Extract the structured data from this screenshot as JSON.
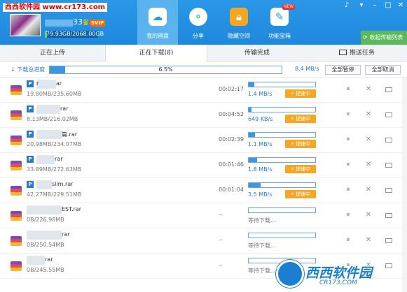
{
  "site_watermark": "西西软件园 www.cr173.com",
  "user": {
    "name_visible": "33",
    "badge": "SVIP",
    "quota_text": "79.93GB/2068.00GB",
    "quota_fraction": 0.0386
  },
  "nav": [
    {
      "label": "我的网盘",
      "icon": "cloud-icon",
      "active": true
    },
    {
      "label": "分享",
      "icon": "share-icon",
      "active": false
    },
    {
      "label": "隐藏空间",
      "icon": "lock-icon",
      "active": false
    },
    {
      "label": "功能宝箱",
      "icon": "toolbox-icon",
      "active": false,
      "badge": "NEW"
    }
  ],
  "window_controls": [
    "bell-icon",
    "menu-icon",
    "minimize-icon",
    "maximize-icon",
    "close-icon"
  ],
  "transfer_list_button": "收起传输列表",
  "tabs": {
    "upload": "正在上传",
    "download": "正在下载(8)",
    "done": "传输完成",
    "push": "推送任务"
  },
  "summary": {
    "label": "下载总进度",
    "percent_text": "6.5%",
    "fraction": 0.065,
    "speed": "8.4 MB/s",
    "pause_all": "全部暂停",
    "cancel_all": "全部取消"
  },
  "downloads": [
    {
      "name": "r",
      "ext": "ar",
      "size": "19.80MB/235.60MB",
      "time": "00:02:17",
      "speed": "1.4 MB/s",
      "fraction": 0.084,
      "boost": "提速中",
      "status": "downloading",
      "has_p": true
    },
    {
      "name": "",
      "ext": "rar",
      "size": "8.13MB/216.02MB",
      "time": "00:04:52",
      "speed": "649 KB/s",
      "fraction": 0.038,
      "boost": "提速中",
      "status": "downloading",
      "has_p": true
    },
    {
      "name": "",
      "ext": "篇.rar",
      "size": "20.98MB/234.07MB",
      "time": "00:02:39",
      "speed": "1.1 MB/s",
      "fraction": 0.09,
      "boost": "提速中",
      "status": "downloading",
      "has_p": true
    },
    {
      "name": "",
      "ext": "rar",
      "size": "33.89MB/272.63MB",
      "time": "00:01:46",
      "speed": "1.8 MB/s",
      "fraction": 0.124,
      "boost": "提速中",
      "status": "downloading",
      "has_p": true
    },
    {
      "name": "",
      "ext": "slim.rar",
      "size": "42.27MB/229.51MB",
      "time": "00:01:04",
      "speed": "3.5 MB/s",
      "fraction": 0.184,
      "boost": "提速中",
      "status": "downloading",
      "has_p": true
    },
    {
      "name": "",
      "ext": "EST.rar",
      "size": "0B/226.98MB",
      "time": "--",
      "status_text": "等待下载...",
      "fraction": 0,
      "status": "waiting",
      "has_p": false
    },
    {
      "name": "",
      "ext": "rar",
      "size": "0B/250.54MB",
      "time": "--",
      "status_text": "等待下载...",
      "fraction": 0,
      "status": "waiting",
      "has_p": false
    },
    {
      "name": "",
      "ext": "rar",
      "size": "0B/245.55MB",
      "time": "--",
      "status_text": "等待下载...",
      "fraction": 0,
      "status": "waiting",
      "has_p": false
    }
  ],
  "bottom_watermark": {
    "brand": "西西软件园",
    "url": "CR173.COM"
  },
  "colors": {
    "header": "#2a98e8",
    "accent": "#3d97e0",
    "boost": "#f5a623",
    "green": "#5cb85c"
  }
}
